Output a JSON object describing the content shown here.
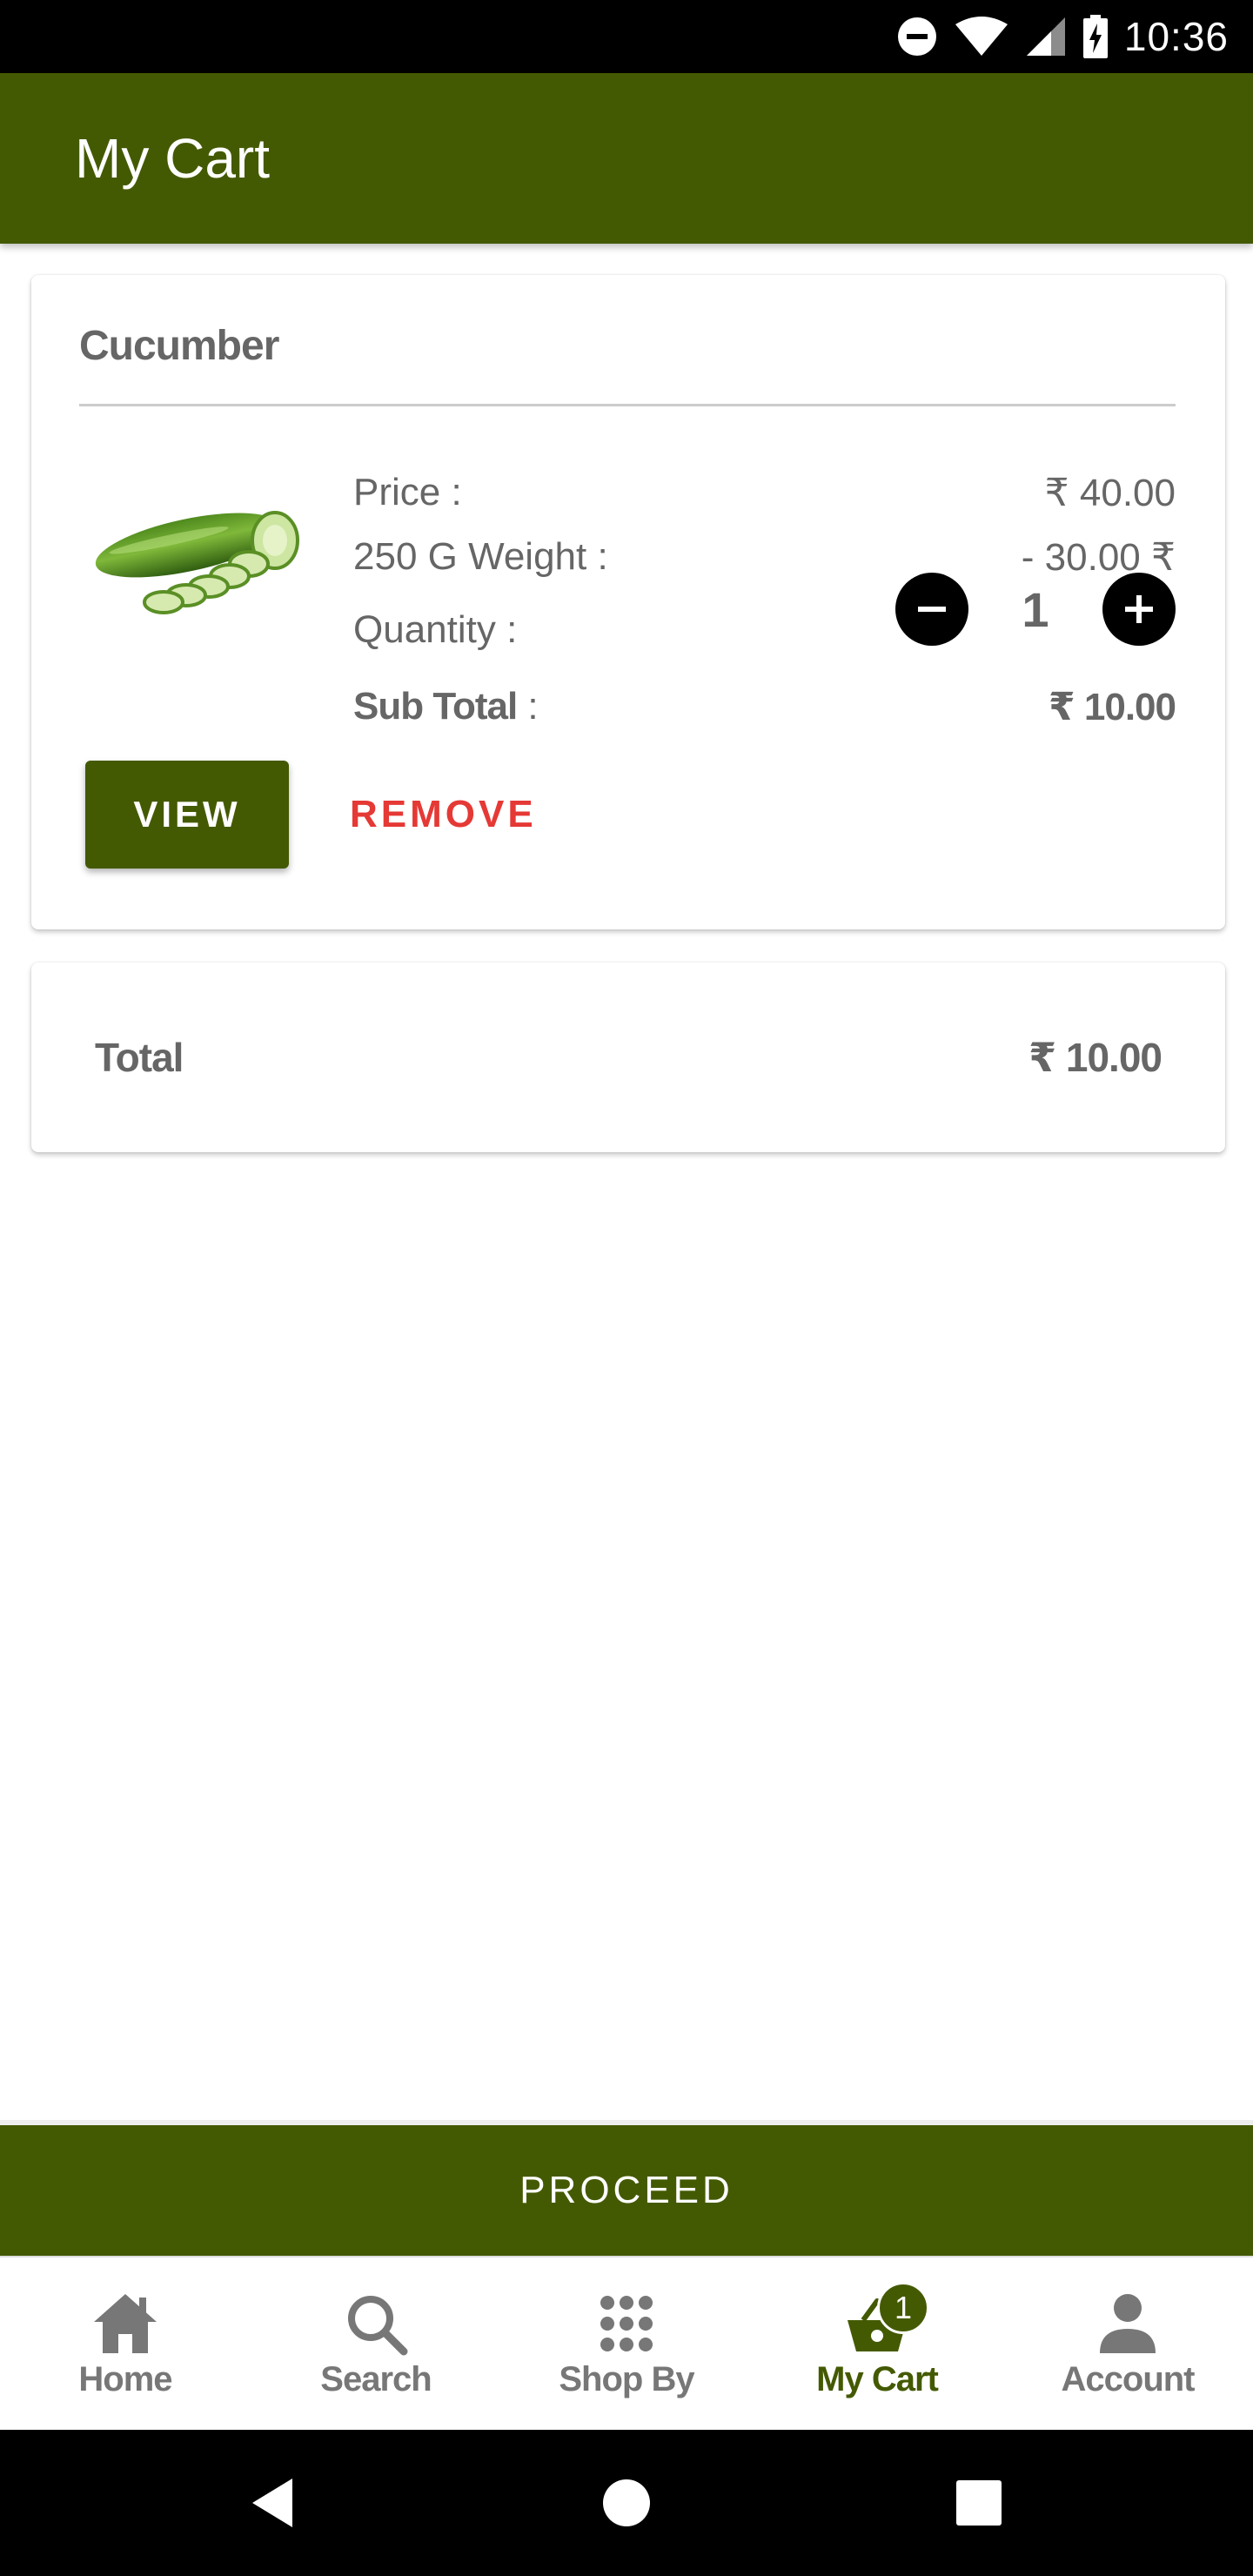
{
  "status_bar": {
    "time": "10:36",
    "icons": [
      "do-not-disturb-icon",
      "wifi-icon",
      "signal-icon",
      "battery-charging-icon"
    ]
  },
  "app_bar": {
    "title": "My Cart"
  },
  "cart": {
    "items": [
      {
        "name": "Cucumber",
        "image": "cucumber-image",
        "price_label": "Price :",
        "price_value": "₹ 40.00",
        "weight_label": "250 G Weight :",
        "weight_value": "- 30.00 ₹",
        "quantity_label": "Quantity  :",
        "quantity": "1",
        "subtotal_label": "Sub Total",
        "subtotal_colon": " :",
        "subtotal_value": "₹ 10.00",
        "view_label": "VIEW",
        "remove_label": "REMOVE"
      }
    ],
    "total_label": "Total",
    "total_value": "₹ 10.00"
  },
  "proceed_label": "PROCEED",
  "bottom_nav": {
    "items": [
      {
        "label": "Home",
        "icon": "home-icon",
        "active": false
      },
      {
        "label": "Search",
        "icon": "search-icon",
        "active": false
      },
      {
        "label": "Shop By",
        "icon": "grid-icon",
        "active": false
      },
      {
        "label": "My Cart",
        "icon": "basket-icon",
        "active": true,
        "badge": "1"
      },
      {
        "label": "Account",
        "icon": "person-icon",
        "active": false
      }
    ]
  },
  "system_nav": {
    "buttons": [
      "back-icon",
      "home-circle-icon",
      "recents-icon"
    ]
  },
  "colors": {
    "primary": "#445a02",
    "remove": "#e53935",
    "text_gray": "#666666",
    "nav_gray": "#777777"
  }
}
